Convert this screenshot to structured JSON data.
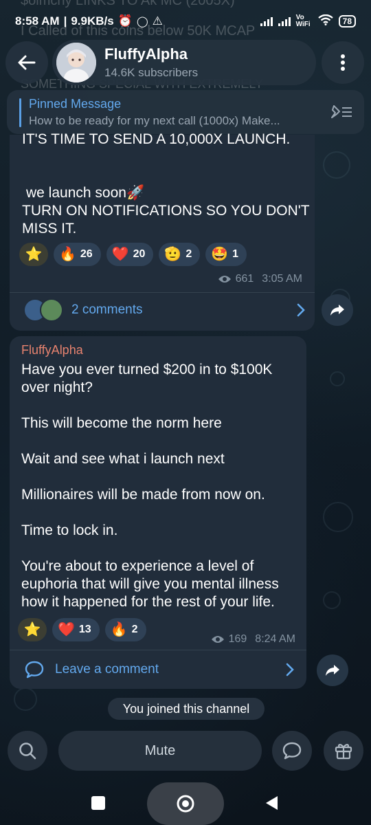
{
  "status_bar": {
    "time": "8:58 AM",
    "net_speed": "9.9KB/s",
    "battery": "78",
    "wifi_label": "Vo\nWiFi"
  },
  "ghost_text": {
    "line1": "$olmchy LINKS TO Ak MC (2005X)",
    "line2": "I Called of this coins below 50K MCAP",
    "line3": "SOMETHING SPECIAL WITH EXTREMELY"
  },
  "header": {
    "channel_name": "FluffyAlpha",
    "subscribers": "14.6K subscribers"
  },
  "pinned": {
    "title": "Pinned Message",
    "text": "How to be ready for my next call (1000x)  Make..."
  },
  "message1": {
    "text_top": "IT'S TIME TO SEND A 10,000X LAUNCH.",
    "text_launch": "we launch soon",
    "text_launch_emoji": "🚀",
    "text_notify": "TURN ON NOTIFICATIONS SO YOU DON'T MISS IT.",
    "reactions": [
      {
        "emoji": "⭐",
        "count": ""
      },
      {
        "emoji": "🔥",
        "count": "26"
      },
      {
        "emoji": "❤️",
        "count": "20"
      },
      {
        "emoji": "🫡",
        "count": "2"
      },
      {
        "emoji": "🤩",
        "count": "1"
      }
    ],
    "views": "661",
    "time": "3:05 AM",
    "comments": "2 comments"
  },
  "message2": {
    "sender": "FluffyAlpha",
    "text": "Have you ever turned $200 in to $100K over night?\n\nThis will become the norm here\n\nWait and see what i launch next\n\nMillionaires will be made from now on.\n\nTime to lock in.\n\nYou're about to experience a level of euphoria that will give you mental illness how it happened for the rest of your life.",
    "reactions": [
      {
        "emoji": "⭐",
        "count": ""
      },
      {
        "emoji": "❤️",
        "count": "13"
      },
      {
        "emoji": "🔥",
        "count": "2"
      }
    ],
    "views": "169",
    "time": "8:24 AM",
    "comments": "Leave a comment"
  },
  "service": {
    "joined": "You joined this channel"
  },
  "bottom": {
    "mute_label": "Mute"
  },
  "colors": {
    "accent": "#63a9ee",
    "sender": "#e8836f",
    "bubble": "#212d3b",
    "reaction_bg": "#2f4156"
  }
}
